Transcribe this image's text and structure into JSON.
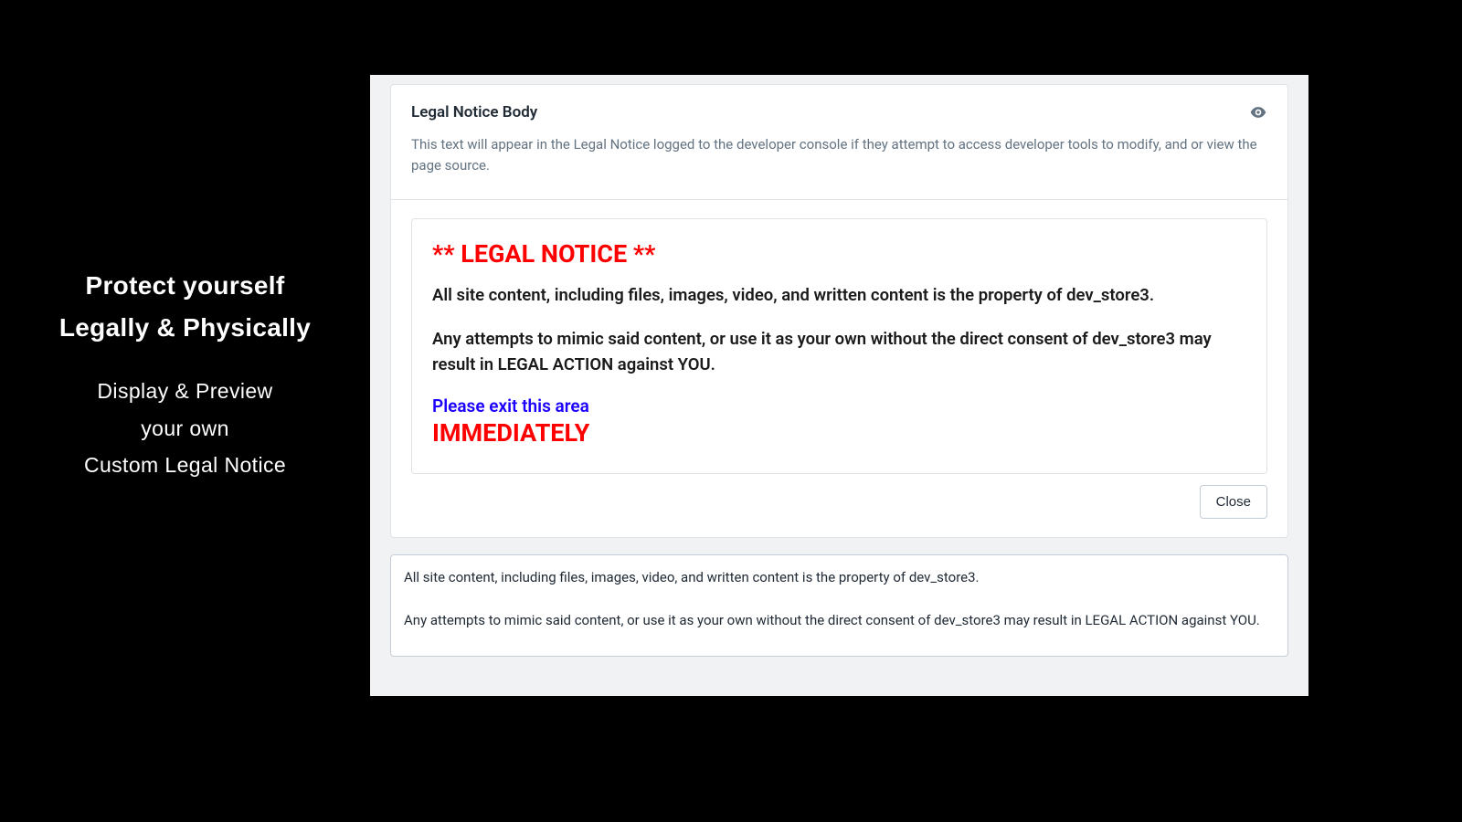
{
  "left": {
    "title_line1": "Protect yourself",
    "title_line2": "Legally & Physically",
    "sub_line1": "Display & Preview",
    "sub_line2": "your own",
    "sub_line3": "Custom Legal Notice"
  },
  "card": {
    "title": "Legal Notice Body",
    "description": "This text will appear in the Legal Notice logged to the developer console if they attempt to access developer tools to modify, and or view the page source."
  },
  "preview": {
    "heading": "** LEGAL NOTICE **",
    "para1": "All site content, including files, images, video, and written content is the property of dev_store3.",
    "para2": "Any attempts to mimic said content, or use it as your own without the direct consent of dev_store3 may result in LEGAL ACTION against YOU.",
    "exit_line": "Please exit this area",
    "immediately": "IMMEDIATELY"
  },
  "buttons": {
    "close": "Close"
  },
  "textarea_value": "All site content, including files, images, video, and written content is the property of dev_store3.\n\nAny attempts to mimic said content, or use it as your own without the direct consent of dev_store3 may result in LEGAL ACTION against YOU."
}
